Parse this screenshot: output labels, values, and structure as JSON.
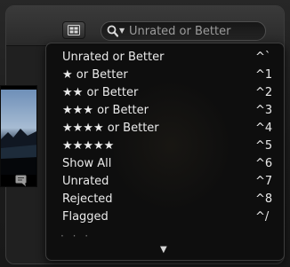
{
  "search": {
    "placeholder": "Unrated or Better",
    "icon": "search-icon"
  },
  "toolbar": {
    "view_button_icon": "browser-view-icon"
  },
  "menu": {
    "items": [
      {
        "label": "Unrated or Better",
        "shortcut": "^`"
      },
      {
        "label": "★ or Better",
        "shortcut": "^1"
      },
      {
        "label": "★★ or Better",
        "shortcut": "^2"
      },
      {
        "label": "★★★ or Better",
        "shortcut": "^3"
      },
      {
        "label": "★★★★ or Better",
        "shortcut": "^4"
      },
      {
        "label": "★★★★★",
        "shortcut": "^5"
      },
      {
        "label": "Show All",
        "shortcut": "^6"
      },
      {
        "label": "Unrated",
        "shortcut": "^7"
      },
      {
        "label": "Rejected",
        "shortcut": "^8"
      },
      {
        "label": "Flagged",
        "shortcut": "^/"
      }
    ],
    "more_indicator": "· · ·",
    "scroll_down_glyph": "▼"
  },
  "colors": {
    "menu_background": "#0e0e0e",
    "menu_text": "#eaeaea",
    "toolbar_background": "#323232"
  }
}
